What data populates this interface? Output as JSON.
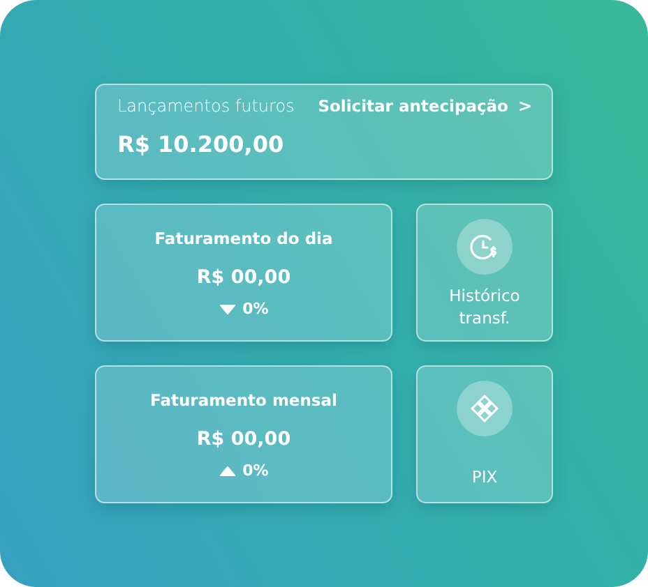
{
  "future_entries": {
    "label": "Lançamentos futuros",
    "link": "Solicitar antecipação",
    "link_icon": ">",
    "amount": "R$ 10.200,00"
  },
  "revenue_cards": [
    {
      "title": "Faturamento do dia",
      "amount": "R$ 00,00",
      "kind": "down",
      "change": "0%"
    },
    {
      "title": "Faturamento mensal",
      "amount": "R$ 00,00",
      "kind": "up",
      "change": "0%"
    }
  ],
  "shortcuts": [
    {
      "kind": "history",
      "label": "Histórico transf."
    },
    {
      "kind": "pix",
      "label": "PIX"
    }
  ]
}
